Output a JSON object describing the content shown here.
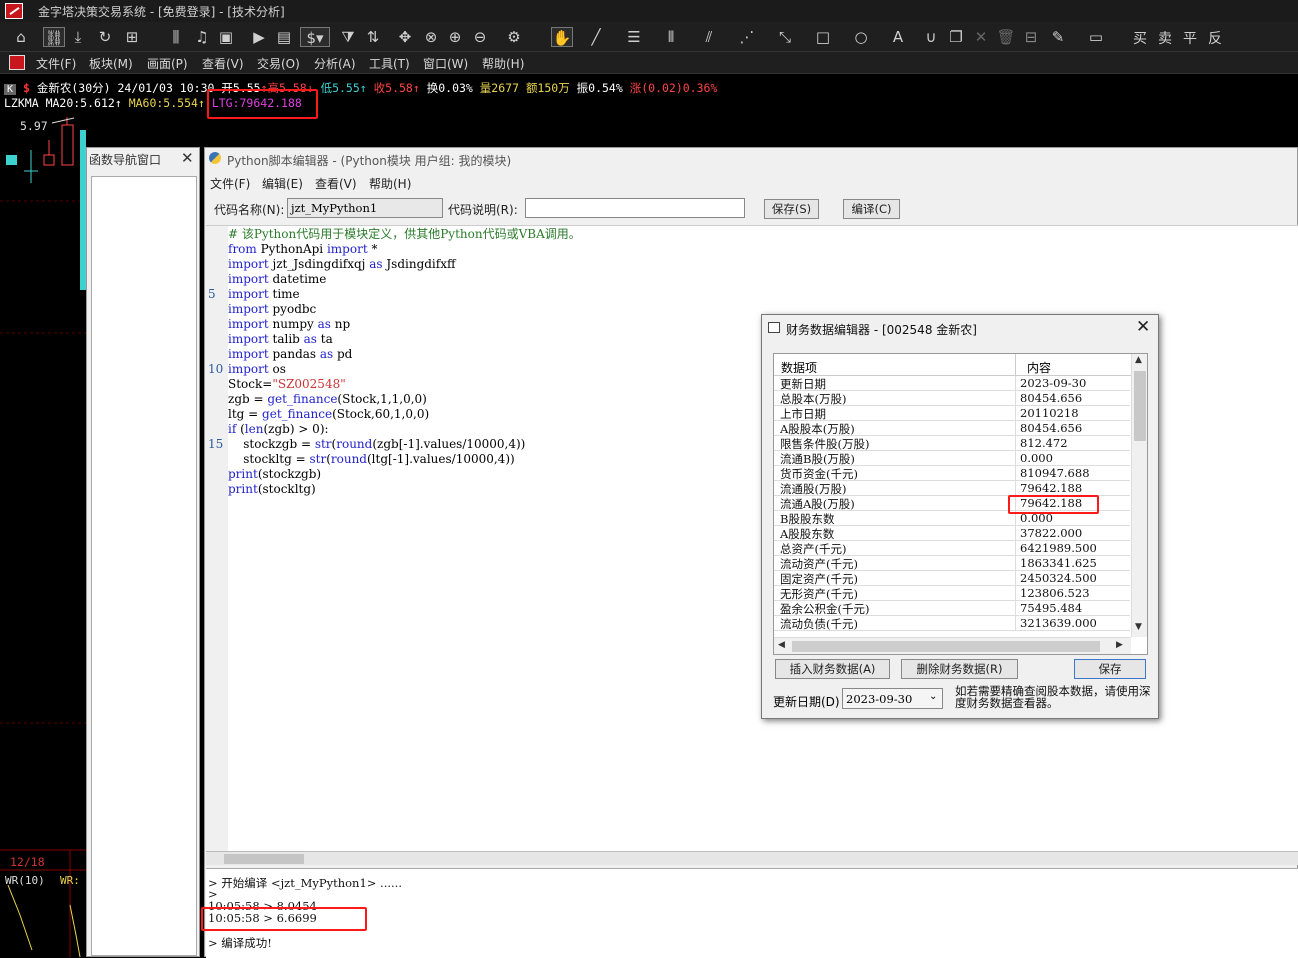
{
  "titlebar": {
    "title": "金字塔决策交易系统 - [免费登录] - [技术分析]"
  },
  "toolbar": {
    "buttons": [
      "home-icon",
      "link-icon",
      "download-icon",
      "refresh-icon",
      "grid-icon",
      "candlestick-icon",
      "bell-icon",
      "chart-icon",
      "play-icon",
      "document-icon",
      "dollar-icon",
      "filter-icon",
      "sort-icon",
      "move-icon",
      "cross-icon",
      "zoom-in-icon",
      "zoom-out-icon",
      "settings-icon",
      "hand-icon",
      "line-icon",
      "fib-icon",
      "bars-icon",
      "fan-icon",
      "parallel-icon",
      "ray-icon",
      "rect-icon",
      "circle-icon",
      "text-icon",
      "magnet-icon",
      "copy-icon",
      "close-icon",
      "trash-icon",
      "lock-icon",
      "pen-icon",
      "save-icon"
    ],
    "trade_labels": [
      "买",
      "卖",
      "平",
      "反"
    ]
  },
  "menubar": {
    "items": [
      "文件(F)",
      "板块(M)",
      "画面(P)",
      "查看(V)",
      "交易(O)",
      "分析(A)",
      "工具(T)",
      "窗口(W)",
      "帮助(H)"
    ]
  },
  "quote": {
    "symbol_marker": "K",
    "dollar": "$",
    "name_period": "金新农(30分)",
    "datetime": "24/01/03 10:30",
    "open": "开5.55",
    "high": "高5.58",
    "low": "低5.55",
    "close": "收5.58",
    "turnover": "换0.03%",
    "volume": "量2677",
    "amount": "额150万",
    "amplitude": "振0.54%",
    "change": "涨(0.02)0.36%"
  },
  "indicators": {
    "name": "LZKMA",
    "ma20": "MA20:5.612",
    "ma60": "MA60:5.554",
    "ltg": "LTG:79642.188"
  },
  "chart": {
    "price_label": "5.97",
    "date_label": "12/18",
    "wr_label": "WR(10)",
    "wr_label2": "WR:"
  },
  "nav_panel": {
    "title": "函数导航窗口"
  },
  "py_editor": {
    "title": "Python脚本编辑器 - (Python模块 用户组: 我的模块)",
    "menu": [
      "文件(F)",
      "编辑(E)",
      "查看(V)",
      "帮助(H)"
    ],
    "code_name_label": "代码名称(N):",
    "code_name_value": "jzt_MyPython1",
    "code_desc_label": "代码说明(R):",
    "code_desc_value": "",
    "save_btn": "保存(S)",
    "compile_btn": "编译(C)",
    "code_lines": [
      "# 该Python代码用于模块定义，供其他Python代码或VBA调用。",
      "from PythonApi import *",
      "import jzt_Jsdingdifxqj as Jsdingdifxff",
      "import datetime",
      "import time",
      "import pyodbc",
      "import numpy as np",
      "import talib as ta",
      "import pandas as pd",
      "import os",
      "Stock=\"SZ002548\"",
      "zgb = get_finance(Stock,1,1,0,0)",
      "ltg = get_finance(Stock,60,1,0,0)",
      "if (len(zgb) > 0):",
      "    stockzgb = str(round(zgb[-1].values/10000,4))",
      "    stockltg = str(round(ltg[-1].values/10000,4))",
      "print(stockzgb)",
      "print(stockltg)"
    ],
    "line_numbers": [
      "5",
      "10",
      "15"
    ],
    "output": [
      "> 开始编译 <jzt_MyPython1> ......",
      ">",
      "10:05:58 > 8.0454",
      "10:05:58 > 6.6699",
      "> 编译成功!"
    ]
  },
  "fin_dialog": {
    "title": "财务数据编辑器 - [002548 金新农]",
    "col_item": "数据项",
    "col_value": "内容",
    "rows": [
      [
        "更新日期",
        "2023-09-30"
      ],
      [
        "总股本(万股)",
        "80454.656"
      ],
      [
        "上市日期",
        "20110218"
      ],
      [
        "A股股本(万股)",
        "80454.656"
      ],
      [
        "限售条件股(万股)",
        "812.472"
      ],
      [
        "流通B股(万股)",
        "0.000"
      ],
      [
        "货币资金(千元)",
        "810947.688"
      ],
      [
        "流通股(万股)",
        "79642.188"
      ],
      [
        "流通A股(万股)",
        "79642.188"
      ],
      [
        "B股股东数",
        "0.000"
      ],
      [
        "A股股东数",
        "37822.000"
      ],
      [
        "总资产(千元)",
        "6421989.500"
      ],
      [
        "流动资产(千元)",
        "1863341.625"
      ],
      [
        "固定资产(千元)",
        "2450324.500"
      ],
      [
        "无形资产(千元)",
        "123806.523"
      ],
      [
        "盈余公积金(千元)",
        "75495.484"
      ],
      [
        "流动负债(千元)",
        "3213639.000"
      ]
    ],
    "insert_btn": "插入财务数据(A)",
    "delete_btn": "删除财务数据(R)",
    "save_btn": "保存",
    "date_label": "更新日期(D)",
    "date_value": "2023-09-30",
    "note": "如若需要精确查阅股本数据，请使用深度财务数据查看器。"
  }
}
